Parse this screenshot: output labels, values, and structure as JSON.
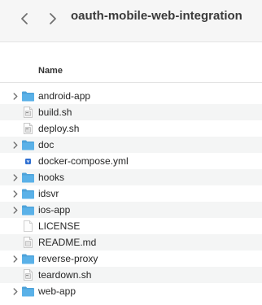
{
  "window": {
    "title": "oauth-mobile-web-integration"
  },
  "columns": {
    "name": "Name"
  },
  "items": [
    {
      "label": "android-app",
      "kind": "folder",
      "icon": "folder-icon",
      "expandable": true
    },
    {
      "label": "build.sh",
      "kind": "script",
      "icon": "shell-script-icon",
      "expandable": false
    },
    {
      "label": "deploy.sh",
      "kind": "script",
      "icon": "shell-script-icon",
      "expandable": false
    },
    {
      "label": "doc",
      "kind": "folder",
      "icon": "folder-icon",
      "expandable": true
    },
    {
      "label": "docker-compose.yml",
      "kind": "yaml",
      "icon": "yaml-file-icon",
      "expandable": false
    },
    {
      "label": "hooks",
      "kind": "folder",
      "icon": "folder-icon",
      "expandable": true
    },
    {
      "label": "idsvr",
      "kind": "folder",
      "icon": "folder-icon",
      "expandable": true
    },
    {
      "label": "ios-app",
      "kind": "folder",
      "icon": "folder-icon",
      "expandable": true
    },
    {
      "label": "LICENSE",
      "kind": "document",
      "icon": "document-icon",
      "expandable": false
    },
    {
      "label": "README.md",
      "kind": "script",
      "icon": "markdown-file-icon",
      "expandable": false
    },
    {
      "label": "reverse-proxy",
      "kind": "folder",
      "icon": "folder-icon",
      "expandable": true
    },
    {
      "label": "teardown.sh",
      "kind": "script",
      "icon": "shell-script-icon",
      "expandable": false
    },
    {
      "label": "web-app",
      "kind": "folder",
      "icon": "folder-icon",
      "expandable": true
    }
  ],
  "colors": {
    "folder": "#5ab1e8",
    "folder_tab": "#4ea2d9",
    "yaml_badge": "#2f6fd1"
  }
}
